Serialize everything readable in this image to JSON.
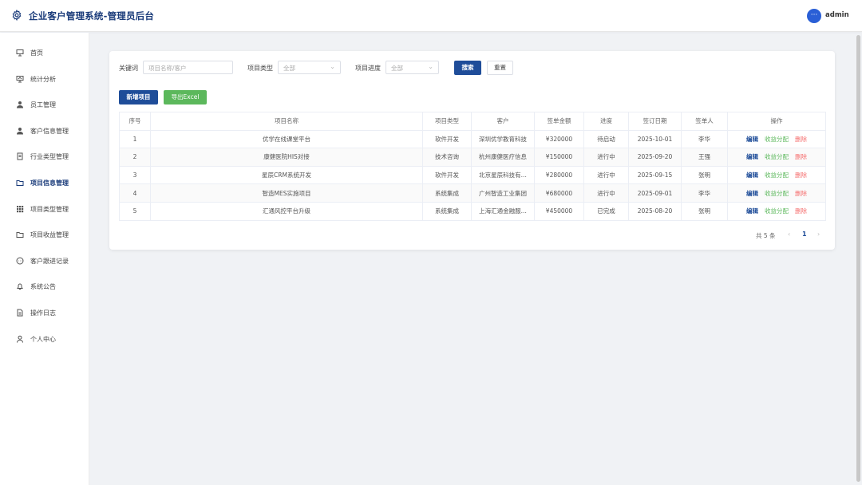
{
  "header": {
    "title": "企业客户管理系统-管理员后台",
    "user": "admin",
    "avatar_text": "···"
  },
  "sidebar": {
    "items": [
      {
        "label": "首页",
        "icon": "home-icon"
      },
      {
        "label": "统计分析",
        "icon": "chart-icon"
      },
      {
        "label": "员工管理",
        "icon": "person-icon"
      },
      {
        "label": "客户信息管理",
        "icon": "person-icon"
      },
      {
        "label": "行业类型管理",
        "icon": "document-icon"
      },
      {
        "label": "项目信息管理",
        "icon": "folder-icon",
        "active": true
      },
      {
        "label": "项目类型管理",
        "icon": "grid-icon"
      },
      {
        "label": "项目收益管理",
        "icon": "folder-icon"
      },
      {
        "label": "客户跟进记录",
        "icon": "chat-icon"
      },
      {
        "label": "系统公告",
        "icon": "bell-icon"
      },
      {
        "label": "操作日志",
        "icon": "log-icon"
      },
      {
        "label": "个人中心",
        "icon": "user-icon"
      }
    ]
  },
  "filters": {
    "keyword_label": "关键词",
    "keyword_placeholder": "项目名称/客户",
    "type_label": "项目类型",
    "type_value": "全部",
    "progress_label": "项目进度",
    "progress_value": "全部",
    "search_label": "搜索",
    "reset_label": "重置"
  },
  "actions": {
    "add_label": "新增项目",
    "export_label": "导出Excel"
  },
  "table": {
    "columns": [
      "序号",
      "项目名称",
      "项目类型",
      "客户",
      "签单金额",
      "进度",
      "签订日期",
      "签单人",
      "操作"
    ],
    "rows": [
      {
        "no": "1",
        "name": "优学在线课堂平台",
        "type": "软件开发",
        "client": "深圳优学教育科技",
        "amount": "¥320000",
        "progress": "待启动",
        "date": "2025-10-01",
        "signer": "李华"
      },
      {
        "no": "2",
        "name": "康健医院HIS对接",
        "type": "技术咨询",
        "client": "杭州康健医疗信息",
        "amount": "¥150000",
        "progress": "进行中",
        "date": "2025-09-20",
        "signer": "王强"
      },
      {
        "no": "3",
        "name": "星辰CRM系统开发",
        "type": "软件开发",
        "client": "北京星辰科技有...",
        "amount": "¥280000",
        "progress": "进行中",
        "date": "2025-09-15",
        "signer": "张明"
      },
      {
        "no": "4",
        "name": "智造MES实施项目",
        "type": "系统集成",
        "client": "广州智造工业集团",
        "amount": "¥680000",
        "progress": "进行中",
        "date": "2025-09-01",
        "signer": "李华"
      },
      {
        "no": "5",
        "name": "汇通风控平台升级",
        "type": "系统集成",
        "client": "上海汇通金融服...",
        "amount": "¥450000",
        "progress": "已完成",
        "date": "2025-08-20",
        "signer": "张明"
      }
    ],
    "ops": {
      "edit": "编辑",
      "share": "收益分配",
      "delete": "删除"
    }
  },
  "pagination": {
    "total": "共 5 条",
    "current": "1",
    "prev": "‹",
    "next": "›"
  },
  "colors": {
    "brand": "#1a3b7a",
    "primary": "#1f4d99",
    "success": "#5cb85c",
    "danger": "#f56c6c"
  }
}
